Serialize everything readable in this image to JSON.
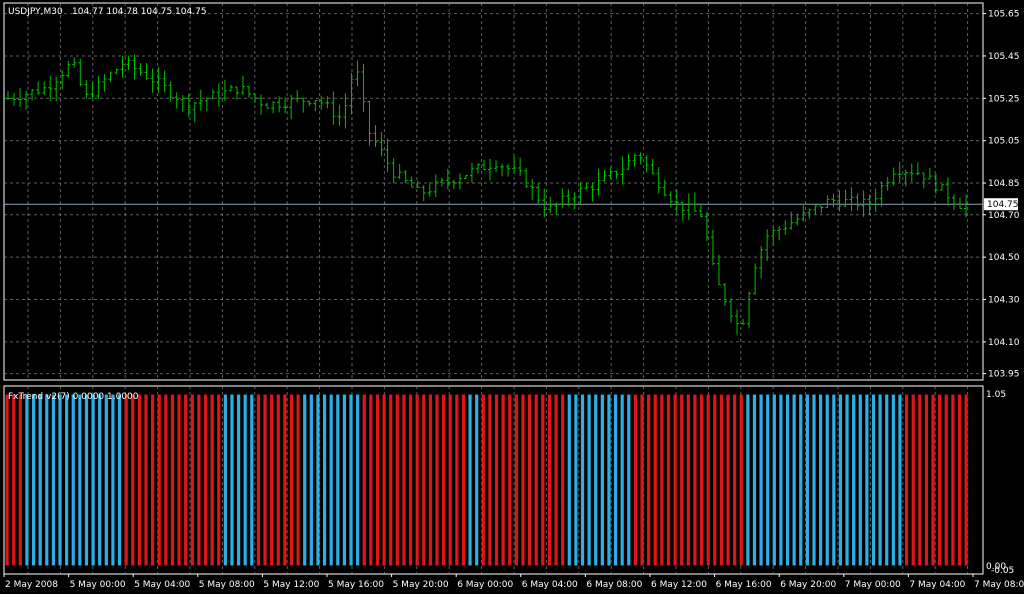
{
  "colors": {
    "background": "#000000",
    "frame": "#ffffff",
    "grid": "#9aa0a6",
    "bars_up": "#00c000",
    "current_price_line": "#8fa3b8",
    "trend_up": "#2ab0e6",
    "trend_down": "#e01515",
    "price_tag_bg": "#ffffff",
    "price_tag_text": "#000000"
  },
  "main": {
    "symbol_caption": "USDJPY,M30",
    "ohlc_caption": "104.77 104.78 104.75 104.75",
    "current_price_label": "104.75"
  },
  "indicator": {
    "caption": "FxTrend v2(7) 0.0000 1.0000",
    "top_label": "1.05",
    "bottom_label": "0.00",
    "bottom_label2": "-0.05"
  },
  "chart_data": [
    {
      "type": "ohlc",
      "series": [
        {
          "name": "USDJPY,M30"
        }
      ],
      "y_ticks": [
        "105.65",
        "105.45",
        "105.25",
        "105.05",
        "104.85",
        "104.70",
        "104.50",
        "104.30",
        "104.10",
        "103.95"
      ],
      "y_tick_values": [
        105.65,
        105.45,
        105.25,
        105.05,
        104.85,
        104.7,
        104.5,
        104.3,
        104.1,
        103.95
      ],
      "ylim": [
        103.92,
        105.7
      ],
      "current_price": 104.75,
      "grid": true,
      "x_labels": [
        "2 May 2008",
        "5 May 00:00",
        "5 May 04:00",
        "5 May 08:00",
        "5 May 12:00",
        "5 May 16:00",
        "5 May 20:00",
        "6 May 00:00",
        "6 May 04:00",
        "6 May 08:00",
        "6 May 12:00",
        "6 May 16:00",
        "6 May 20:00",
        "7 May 00:00",
        "7 May 04:00",
        "7 May 08:00"
      ],
      "close_path": [
        [
          0,
          105.25
        ],
        [
          6,
          105.3
        ],
        [
          10,
          105.42
        ],
        [
          12,
          105.25
        ],
        [
          18,
          105.42
        ],
        [
          22,
          105.35
        ],
        [
          28,
          105.22
        ],
        [
          36,
          105.3
        ],
        [
          40,
          105.22
        ],
        [
          48,
          105.25
        ],
        [
          52,
          105.15
        ],
        [
          54,
          105.42
        ],
        [
          56,
          105.1
        ],
        [
          60,
          104.9
        ],
        [
          64,
          104.8
        ],
        [
          70,
          104.88
        ],
        [
          76,
          104.95
        ],
        [
          80,
          104.88
        ],
        [
          84,
          104.72
        ],
        [
          88,
          104.8
        ],
        [
          92,
          104.85
        ],
        [
          96,
          104.93
        ],
        [
          98,
          105.0
        ],
        [
          100,
          104.9
        ],
        [
          104,
          104.75
        ],
        [
          108,
          104.7
        ],
        [
          110,
          104.4
        ],
        [
          114,
          104.15
        ],
        [
          116,
          104.45
        ],
        [
          118,
          104.6
        ],
        [
          124,
          104.7
        ],
        [
          128,
          104.77
        ],
        [
          134,
          104.75
        ],
        [
          138,
          104.92
        ],
        [
          142,
          104.9
        ],
        [
          146,
          104.8
        ],
        [
          148,
          104.75
        ]
      ]
    },
    {
      "type": "bar",
      "series": [
        {
          "name": "FxTrend v2(7)"
        }
      ],
      "ylim": [
        -0.05,
        1.05
      ],
      "y_ticks": [
        "1.05",
        "0.00",
        "-0.05"
      ],
      "segments": [
        {
          "trend": "down",
          "count": 3
        },
        {
          "trend": "up",
          "count": 15
        },
        {
          "trend": "down",
          "count": 15
        },
        {
          "trend": "up",
          "count": 5
        },
        {
          "trend": "down",
          "count": 7
        },
        {
          "trend": "up",
          "count": 9
        },
        {
          "trend": "down",
          "count": 16
        },
        {
          "trend": "up",
          "count": 2
        },
        {
          "trend": "down",
          "count": 13
        },
        {
          "trend": "up",
          "count": 10
        },
        {
          "trend": "down",
          "count": 17
        },
        {
          "trend": "up",
          "count": 24
        },
        {
          "trend": "down",
          "count": 10
        }
      ]
    }
  ]
}
